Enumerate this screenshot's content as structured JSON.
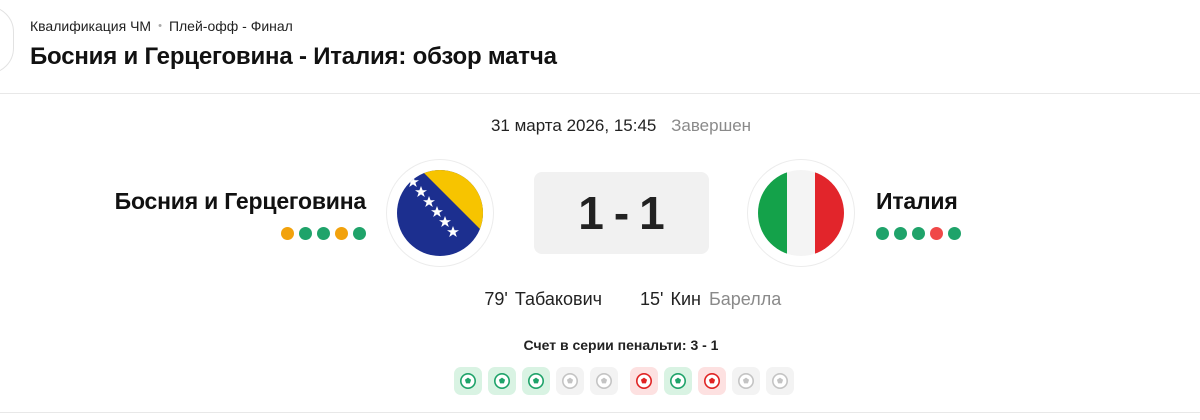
{
  "header": {
    "breadcrumb": [
      "Квалификация ЧМ",
      "Плей-офф - Финал"
    ],
    "title": "Босния и Герцеговина - Италия: обзор матча"
  },
  "match": {
    "date": "31 марта 2026, 15:45",
    "status": "Завершен",
    "score_home": "1",
    "score_sep": "-",
    "score_away": "1"
  },
  "home": {
    "name": "Босния и Герцеговина",
    "flag": "bosnia-flag-icon",
    "form": [
      "draw",
      "win",
      "win",
      "draw",
      "win"
    ],
    "goals": [
      {
        "minute": "79'",
        "scorer": "Табакович"
      }
    ]
  },
  "away": {
    "name": "Италия",
    "flag": "italy-flag-icon",
    "form": [
      "win",
      "win",
      "win",
      "loss",
      "win"
    ],
    "goals": [
      {
        "minute": "15'",
        "scorer": "Кин",
        "assist": "Барелла"
      }
    ]
  },
  "penalties": {
    "title": "Счет в серии пенальти: 3 - 1",
    "home": [
      "scored",
      "scored",
      "scored",
      "none",
      "none"
    ],
    "away": [
      "missed",
      "scored",
      "missed",
      "none",
      "none"
    ]
  },
  "colors": {
    "win": "#1fa36a",
    "draw": "#f2a20c",
    "loss": "#f04848",
    "scored_bg": "#d9f3e3",
    "missed_bg": "#fde1e1",
    "none_bg": "#f3f3f3"
  }
}
